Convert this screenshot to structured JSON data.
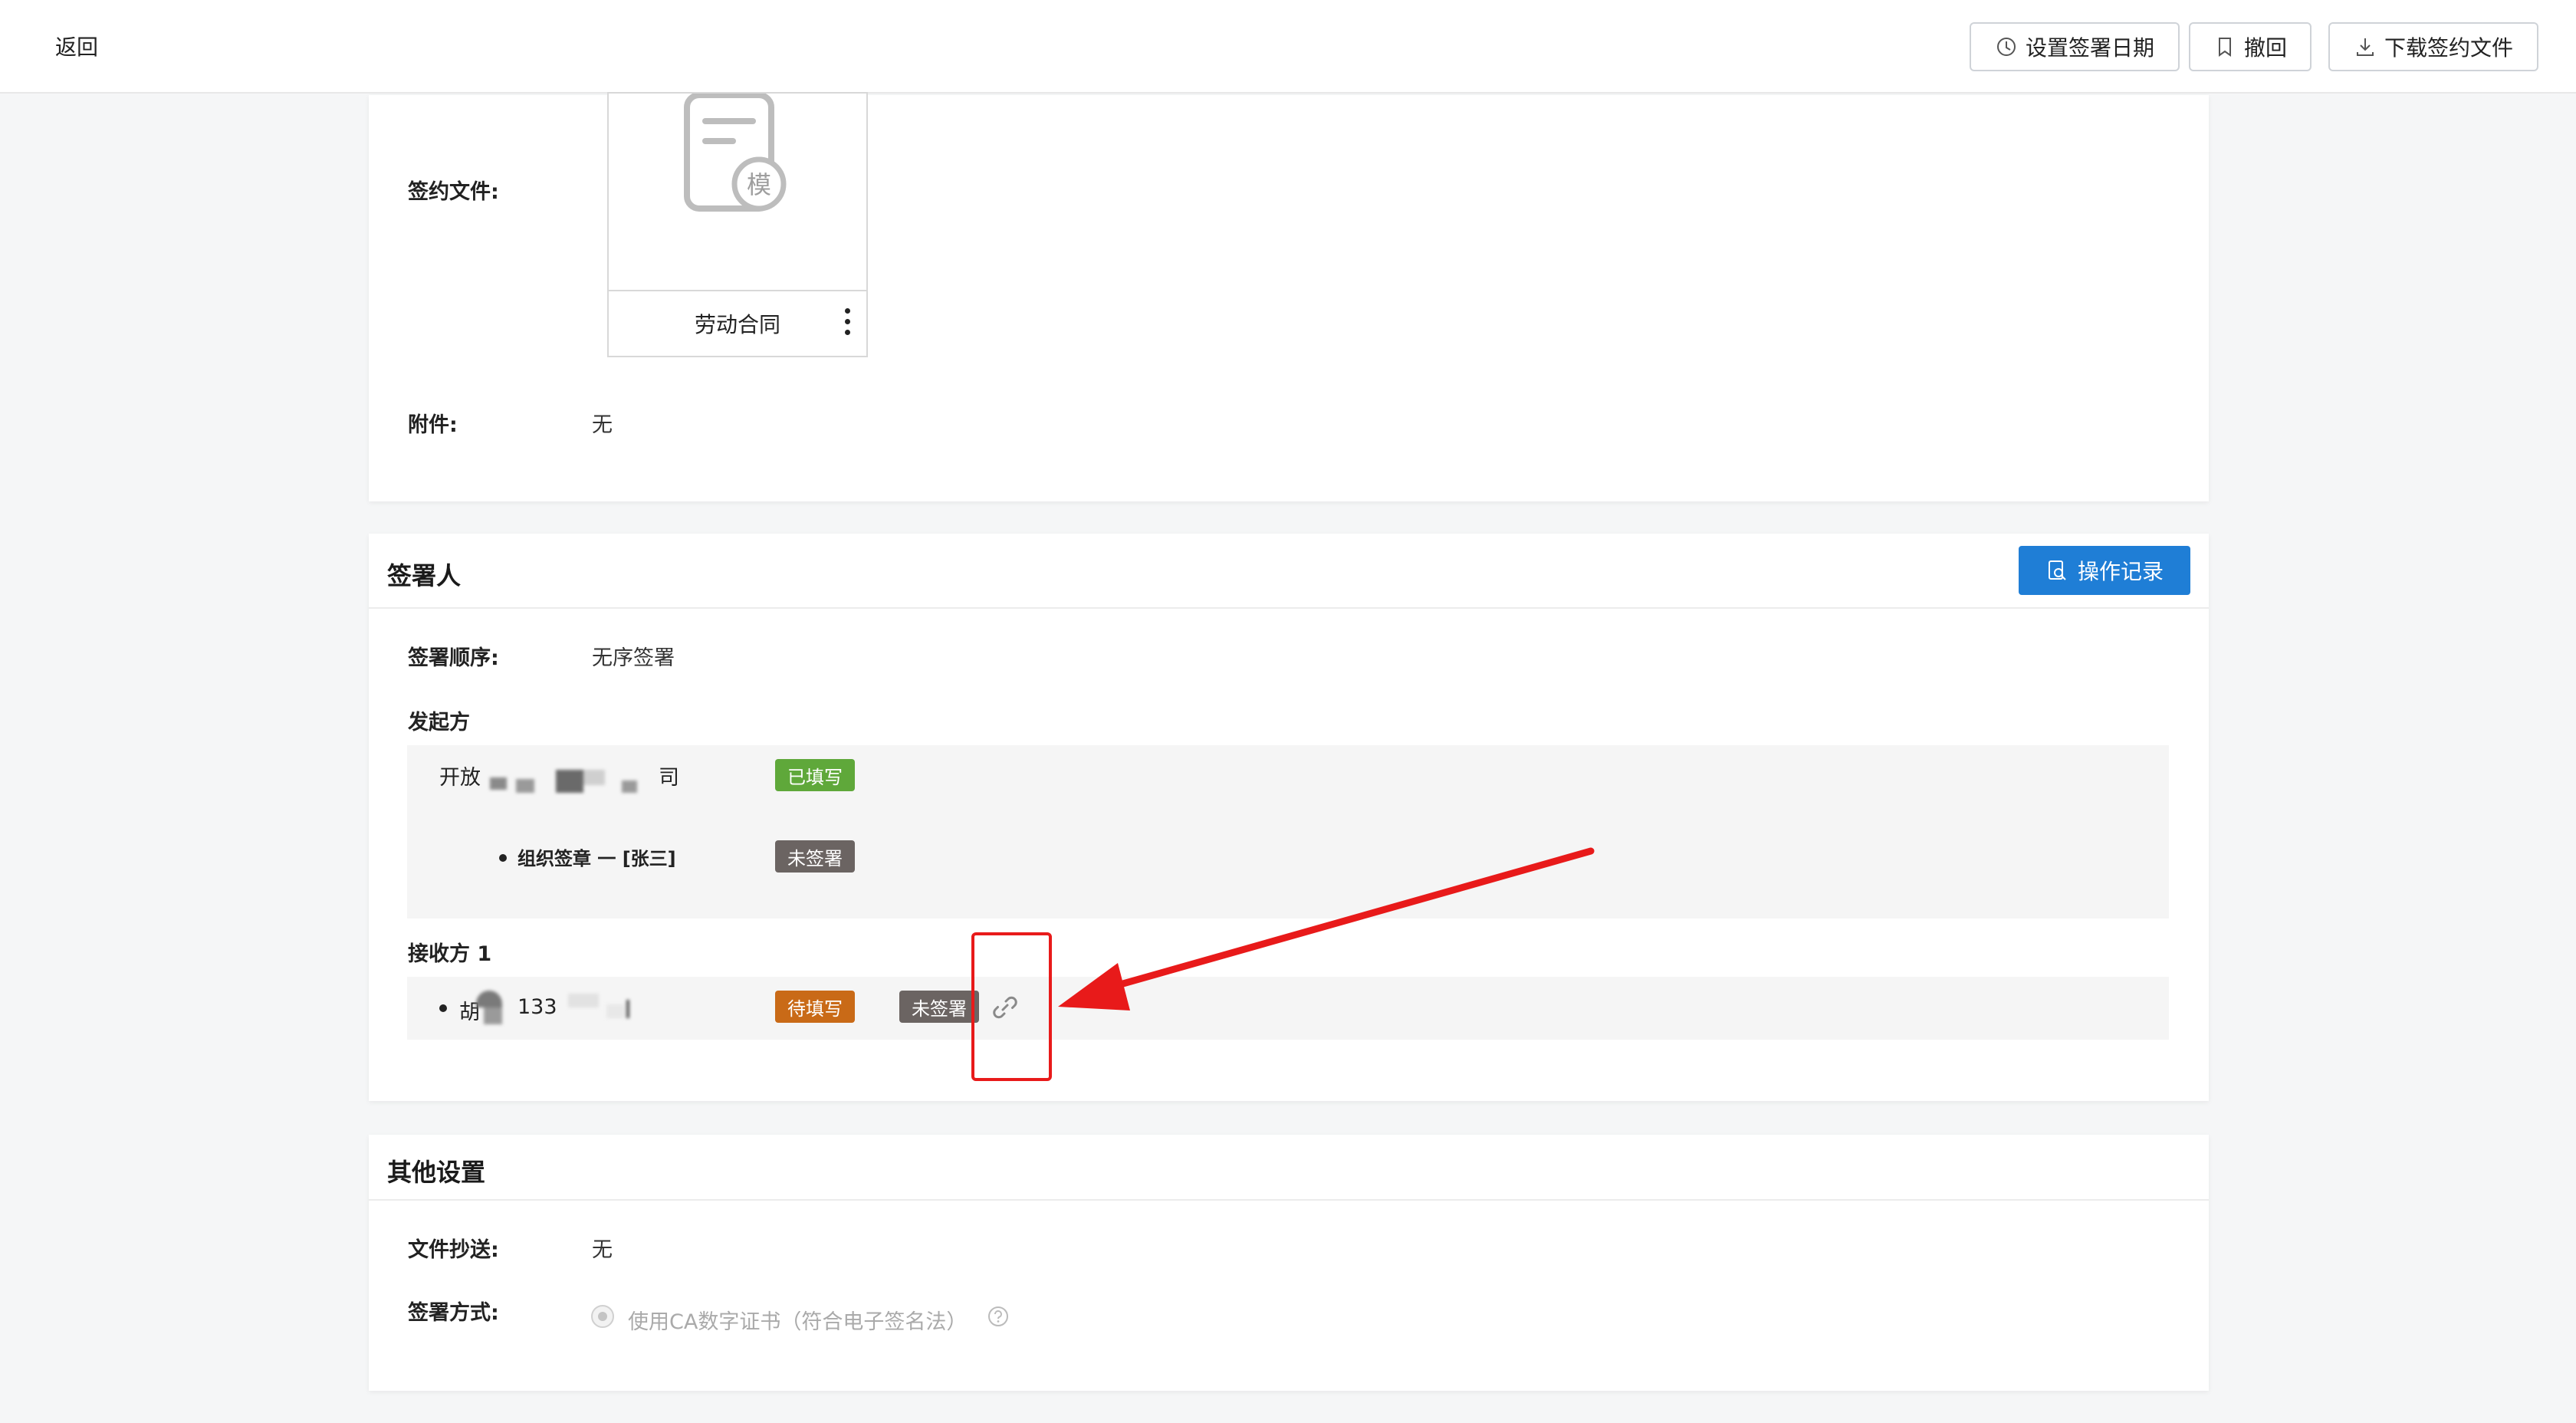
{
  "header": {
    "back_label": "返回",
    "set_date_label": "设置签署日期",
    "revoke_label": "撤回",
    "download_label": "下载签约文件"
  },
  "doc_section": {
    "files_label": "签约文件:",
    "file_name": "劳动合同",
    "file_stamp": "模",
    "attachments_label": "附件:",
    "attachments_value": "无"
  },
  "signers_section": {
    "title": "签署人",
    "operation_log_label": "操作记录",
    "order_label": "签署顺序:",
    "order_value": "无序签署",
    "initiator_label": "发起方",
    "initiator_name_prefix": "开放",
    "initiator_name_suffix": "司",
    "initiator_status": "已填写",
    "org_seal_label": "组织签章 一 [张三]",
    "org_seal_status": "未签署",
    "receiver_label": "接收方 1",
    "receiver_name_prefix": "胡",
    "receiver_phone_prefix": "133",
    "receiver_fill_status": "待填写",
    "receiver_sign_status": "未签署"
  },
  "other_section": {
    "title": "其他设置",
    "cc_label": "文件抄送:",
    "cc_value": "无",
    "sign_method_label": "签署方式:",
    "sign_method_option": "使用CA数字证书（符合电子签名法）"
  },
  "colors": {
    "primary": "#1f7ed6",
    "tag_green": "#5fa83a",
    "tag_gray": "#6b6462",
    "tag_orange": "#c96a17",
    "annotation_red": "#e81a1a"
  }
}
